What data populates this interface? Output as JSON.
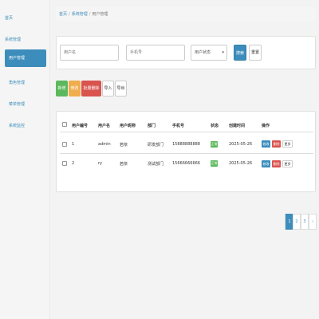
{
  "sidebar": {
    "home": "首页",
    "group": "系统管理",
    "active_item": "用户管理",
    "items": [
      "角色管理",
      "菜单管理",
      "系统监控"
    ]
  },
  "breadcrumb": {
    "items": [
      "首页",
      "系统管理",
      "用户管理"
    ],
    "separator": "/"
  },
  "search": {
    "username_placeholder": "用户名",
    "phone_placeholder": "手机号",
    "status_value": "用户状态",
    "search_label": "搜索",
    "reset_label": "重置"
  },
  "toolbar": {
    "add": "新增",
    "edit": "修改",
    "batch_delete": "批量删除",
    "import": "导入",
    "export": "导出"
  },
  "table": {
    "headers": [
      "用户编号",
      "用户名",
      "用户昵称",
      "部门",
      "手机号",
      "状态",
      "创建时间",
      "操作"
    ],
    "rows": [
      {
        "id": "1",
        "username": "admin",
        "nickname": "若依",
        "dept": "研发部门",
        "phone": "15888888888",
        "status": "正常",
        "created": "2025-05-26"
      },
      {
        "id": "2",
        "username": "ry",
        "nickname": "若依",
        "dept": "测试部门",
        "phone": "15666666666",
        "status": "正常",
        "created": "2025-05-26"
      }
    ],
    "actions": {
      "edit": "修改",
      "delete": "删除",
      "more": "更多"
    }
  },
  "pagination": {
    "prev": "‹",
    "pages": [
      "1",
      "2",
      "3"
    ],
    "next": "›",
    "current": "1"
  },
  "colors": {
    "primary": "#3c8dbc",
    "success": "#5cb85c",
    "warning": "#f0ad4e",
    "danger": "#d9534f"
  }
}
